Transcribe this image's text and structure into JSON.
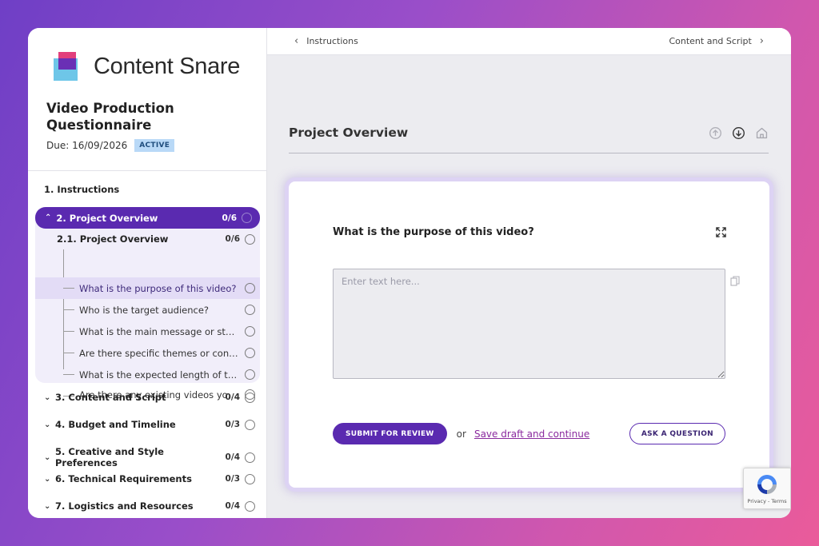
{
  "brand": {
    "name": "Content Snare"
  },
  "questionnaire": {
    "title": "Video Production Questionnaire",
    "due": "Due: 16/09/2026",
    "status": "ACTIVE"
  },
  "nav": {
    "instructions": "1. Instructions",
    "active_section": {
      "label": "2. Project Overview",
      "count": "0/6"
    },
    "subsection": {
      "label": "2.1. Project Overview",
      "count": "0/6"
    },
    "items": [
      "What is the purpose of this video?",
      "Who is the target audience?",
      "What is the main message or story you want to convey?",
      "Are there specific themes or concepts you want to include?",
      "What is the expected length of the video?",
      "Are there any existing videos you'd like us to reference?"
    ],
    "sections": [
      {
        "label": "3. Content and Script",
        "count": "0/4"
      },
      {
        "label": "4. Budget and Timeline",
        "count": "0/3"
      },
      {
        "label": "5. Creative and Style Preferences",
        "count": "0/4"
      },
      {
        "label": "6. Technical Requirements",
        "count": "0/3"
      },
      {
        "label": "7. Logistics and Resources",
        "count": "0/4"
      }
    ]
  },
  "topbar": {
    "prev": "Instructions",
    "next": "Content and Script"
  },
  "main": {
    "section_title": "Project Overview",
    "question": "What is the purpose of this video?",
    "answer_placeholder": "Enter text here...",
    "submit_label": "SUBMIT FOR REVIEW",
    "or_label": "or",
    "save_label": "Save draft and continue",
    "ask_label": "ASK A QUESTION"
  },
  "recaptcha": {
    "text": "Privacy - Terms"
  },
  "colors": {
    "accent": "#5a2ab0",
    "link": "#8a2a9e",
    "badge": "#b9d9f7"
  }
}
